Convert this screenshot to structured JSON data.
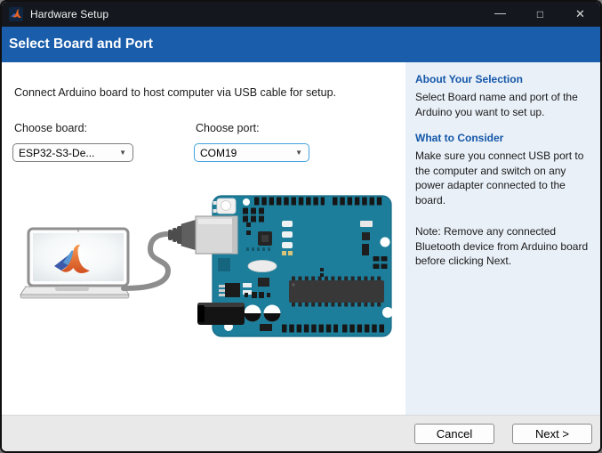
{
  "window": {
    "title": "Hardware Setup"
  },
  "titlebar_icons": {
    "minimize": "—",
    "maximize": "□",
    "close": "✕"
  },
  "header": {
    "title": "Select Board and Port"
  },
  "main": {
    "instruction": "Connect Arduino board to host computer via USB cable for setup.",
    "board": {
      "label": "Choose board:",
      "value": "ESP32-S3-De...",
      "arrow": "▼"
    },
    "port": {
      "label": "Choose port:",
      "value": "COM19",
      "arrow": "▼"
    }
  },
  "sidebar": {
    "sections": [
      {
        "heading": "About Your Selection",
        "body": "Select Board name and port of the Arduino you want to set up."
      },
      {
        "heading": "What to Consider",
        "body": "Make sure you connect USB port to the computer and switch on any power adapter connected to the board."
      }
    ],
    "note": "Note: Remove any connected Bluetooth device from Arduino board before clicking Next."
  },
  "footer": {
    "cancel": "Cancel",
    "next": "Next >"
  },
  "colors": {
    "titlebar-bg": "#14181e",
    "header-bg": "#1a5dab",
    "sidebar-bg": "#e9f0f8",
    "sidebar-heading": "#1457a8",
    "footer-bg": "#e9e9e9",
    "focus-border": "#42a3dd",
    "board-teal": "#1d7e9b"
  }
}
